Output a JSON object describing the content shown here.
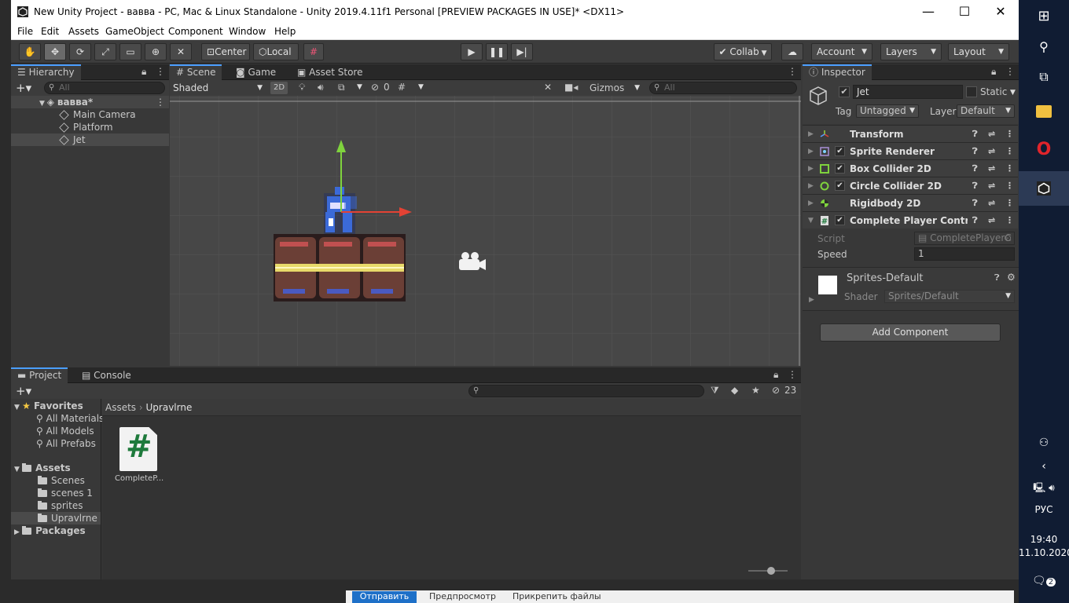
{
  "window": {
    "title": "New Unity Project - вавва - PC, Mac & Linux Standalone - Unity 2019.4.11f1 Personal [PREVIEW PACKAGES IN USE]* <DX11>",
    "minimize": "—",
    "maximize": "☐",
    "close": "✕"
  },
  "menu": [
    "File",
    "Edit",
    "Assets",
    "GameObject",
    "Component",
    "Window",
    "Help"
  ],
  "toolbar": {
    "pivot": "Center",
    "space": "Local",
    "collab": "Collab",
    "account": "Account",
    "layers": "Layers",
    "layout": "Layout"
  },
  "hierarchy": {
    "tab": "Hierarchy",
    "search_placeholder": "All",
    "scene": "вавва*",
    "items": [
      "Main Camera",
      "Platform",
      "Jet"
    ]
  },
  "scene_view": {
    "tabs": [
      "Scene",
      "Game",
      "Asset Store"
    ],
    "shading": "Shaded",
    "mode_2d": "2D",
    "hidden_count": "0",
    "gizmos": "Gizmos",
    "search_placeholder": "All"
  },
  "inspector": {
    "tab": "Inspector",
    "object_name": "Jet",
    "static_label": "Static",
    "tag_label": "Tag",
    "tag_value": "Untagged",
    "layer_label": "Layer",
    "layer_value": "Default",
    "components": [
      "Transform",
      "Sprite Renderer",
      "Box Collider 2D",
      "Circle Collider 2D",
      "Rigidbody 2D",
      "Complete Player Controlle"
    ],
    "script_label": "Script",
    "script_value": "CompletePlayerC",
    "speed_label": "Speed",
    "speed_value": "1",
    "material_name": "Sprites-Default",
    "shader_label": "Shader",
    "shader_value": "Sprites/Default",
    "add_component": "Add Component"
  },
  "project": {
    "tabs": [
      "Project",
      "Console"
    ],
    "hidden_count": "23",
    "favorites_label": "Favorites",
    "favorites": [
      "All Materials",
      "All Models",
      "All Prefabs"
    ],
    "assets_label": "Assets",
    "folders": [
      "Scenes",
      "scenes 1",
      "sprites",
      "Upravlrne"
    ],
    "packages_label": "Packages",
    "breadcrumb": [
      "Assets",
      "Upravlrne"
    ],
    "file_name": "CompleteP...",
    "file_glyph": "#"
  },
  "taskbar": {
    "lang": "РУС",
    "time": "19:40",
    "date": "11.10.2020",
    "notif_count": "2"
  },
  "bottom": {
    "send": "Отправить",
    "preview": "Предпросмотр",
    "attach": "Прикрепить файлы"
  },
  "colors": {
    "accent": "#4a9eff",
    "panel": "#383838",
    "scene_bg": "#474747",
    "axis_x": "#e34234",
    "axis_y": "#7fd33d",
    "script_icon": "#1e7a3c"
  }
}
